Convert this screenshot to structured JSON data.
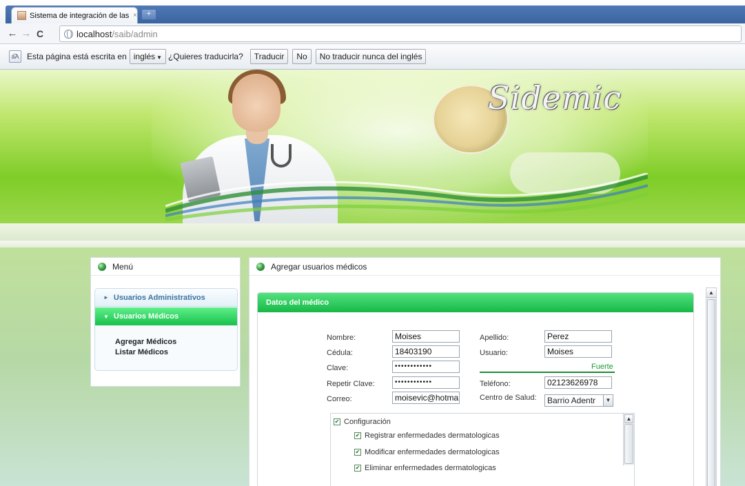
{
  "browser": {
    "tab_title": "Sistema de integración de las c",
    "tab_close": "×",
    "newtab": "+",
    "url_host": "localhost",
    "url_path": "/saib/admin"
  },
  "infobar": {
    "icon_text": "a͡A",
    "text_before": "Esta página está escrita en",
    "language": "inglés",
    "question": "¿Quieres traducirla?",
    "translate": "Traducir",
    "no": "No",
    "never": "No traducir nunca del inglés"
  },
  "banner": {
    "logo": "Sidemic"
  },
  "menu": {
    "title": "Menú",
    "items": [
      {
        "label": "Usuarios Administrativos"
      },
      {
        "label": "Usuarios Médicos"
      }
    ],
    "submenu": [
      {
        "label": "Agregar Médicos"
      },
      {
        "label": "Listar Médicos"
      }
    ]
  },
  "content": {
    "title": "Agregar usuarios médicos",
    "form_title": "Datos del médico",
    "fields": {
      "nombre": {
        "label": "Nombre:",
        "value": "Moises"
      },
      "apellido": {
        "label": "Apellido:",
        "value": "Perez"
      },
      "cedula": {
        "label": "Cédula:",
        "value": "18403190"
      },
      "usuario": {
        "label": "Usuario:",
        "value": "Moises"
      },
      "clave": {
        "label": "Clave:",
        "value": "••••••••••••"
      },
      "repetir": {
        "label": "Repetir Clave:",
        "value": "••••••••••••"
      },
      "telefono": {
        "label": "Teléfono:",
        "value": "02123626978"
      },
      "correo": {
        "label": "Correo:",
        "value": "moisevic@hotma"
      },
      "centro": {
        "label": "Centro de Salud:",
        "value": "Barrio Adentr"
      }
    },
    "strength": "Fuerte",
    "permissions": [
      {
        "label": "Configuración",
        "checked": true
      },
      {
        "label": "Registrar enfermedades dermatologicas",
        "checked": true
      },
      {
        "label": "Modificar enfermedades dermatologicas",
        "checked": true
      },
      {
        "label": "Eliminar enfermedades dermatologicas",
        "checked": true
      }
    ]
  }
}
